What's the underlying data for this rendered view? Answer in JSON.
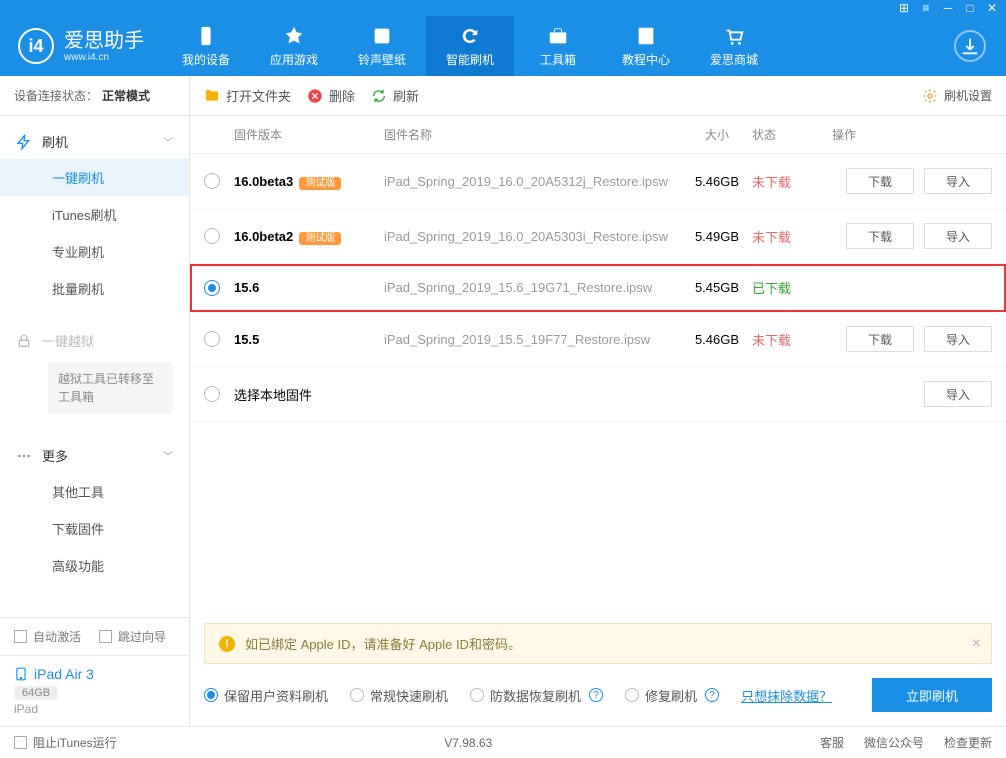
{
  "titlebar_icons": [
    "grid",
    "menu",
    "minimize",
    "maximize",
    "close"
  ],
  "logo": {
    "badge": "i4",
    "main": "爱思助手",
    "sub": "www.i4.cn"
  },
  "nav": [
    {
      "label": "我的设备",
      "icon": "device"
    },
    {
      "label": "应用游戏",
      "icon": "apps"
    },
    {
      "label": "铃声壁纸",
      "icon": "music"
    },
    {
      "label": "智能刷机",
      "icon": "refresh",
      "active": true
    },
    {
      "label": "工具箱",
      "icon": "toolbox"
    },
    {
      "label": "教程中心",
      "icon": "book"
    },
    {
      "label": "爱思商城",
      "icon": "cart"
    }
  ],
  "status": {
    "label": "设备连接状态：",
    "value": "正常模式"
  },
  "sidebar": {
    "flash": {
      "head": "刷机",
      "items": [
        "一键刷机",
        "iTunes刷机",
        "专业刷机",
        "批量刷机"
      ]
    },
    "jailbreak": {
      "head": "一键越狱",
      "note": "越狱工具已转移至工具箱"
    },
    "more": {
      "head": "更多",
      "items": [
        "其他工具",
        "下载固件",
        "高级功能"
      ]
    },
    "checks": {
      "auto": "自动激活",
      "skip": "跳过向导"
    },
    "device": {
      "name": "iPad Air 3",
      "cap": "64GB",
      "type": "iPad"
    }
  },
  "toolbar": {
    "open": "打开文件夹",
    "delete": "删除",
    "refresh": "刷新",
    "settings": "刷机设置"
  },
  "table": {
    "headers": {
      "ver": "固件版本",
      "name": "固件名称",
      "size": "大小",
      "status": "状态",
      "ops": "操作"
    },
    "rows": [
      {
        "ver": "16.0beta3",
        "beta": "测试版",
        "name": "iPad_Spring_2019_16.0_20A5312j_Restore.ipsw",
        "size": "5.46GB",
        "status": "未下载",
        "downloaded": false,
        "selected": false
      },
      {
        "ver": "16.0beta2",
        "beta": "测试版",
        "name": "iPad_Spring_2019_16.0_20A5303i_Restore.ipsw",
        "size": "5.49GB",
        "status": "未下载",
        "downloaded": false,
        "selected": false
      },
      {
        "ver": "15.6",
        "beta": "",
        "name": "iPad_Spring_2019_15.6_19G71_Restore.ipsw",
        "size": "5.45GB",
        "status": "已下载",
        "downloaded": true,
        "selected": true,
        "highlight": true
      },
      {
        "ver": "15.5",
        "beta": "",
        "name": "iPad_Spring_2019_15.5_19F77_Restore.ipsw",
        "size": "5.46GB",
        "status": "未下载",
        "downloaded": false,
        "selected": false
      }
    ],
    "local": "选择本地固件",
    "btn_dl": "下载",
    "btn_imp": "导入"
  },
  "warning": "如已绑定 Apple ID，请准备好 Apple ID和密码。",
  "options": {
    "items": [
      "保留用户资料刷机",
      "常规快速刷机",
      "防数据恢复刷机",
      "修复刷机"
    ],
    "link": "只想抹除数据？",
    "flash": "立即刷机"
  },
  "footer": {
    "block": "阻止iTunes运行",
    "version": "V7.98.63",
    "links": [
      "客服",
      "微信公众号",
      "检查更新"
    ]
  }
}
